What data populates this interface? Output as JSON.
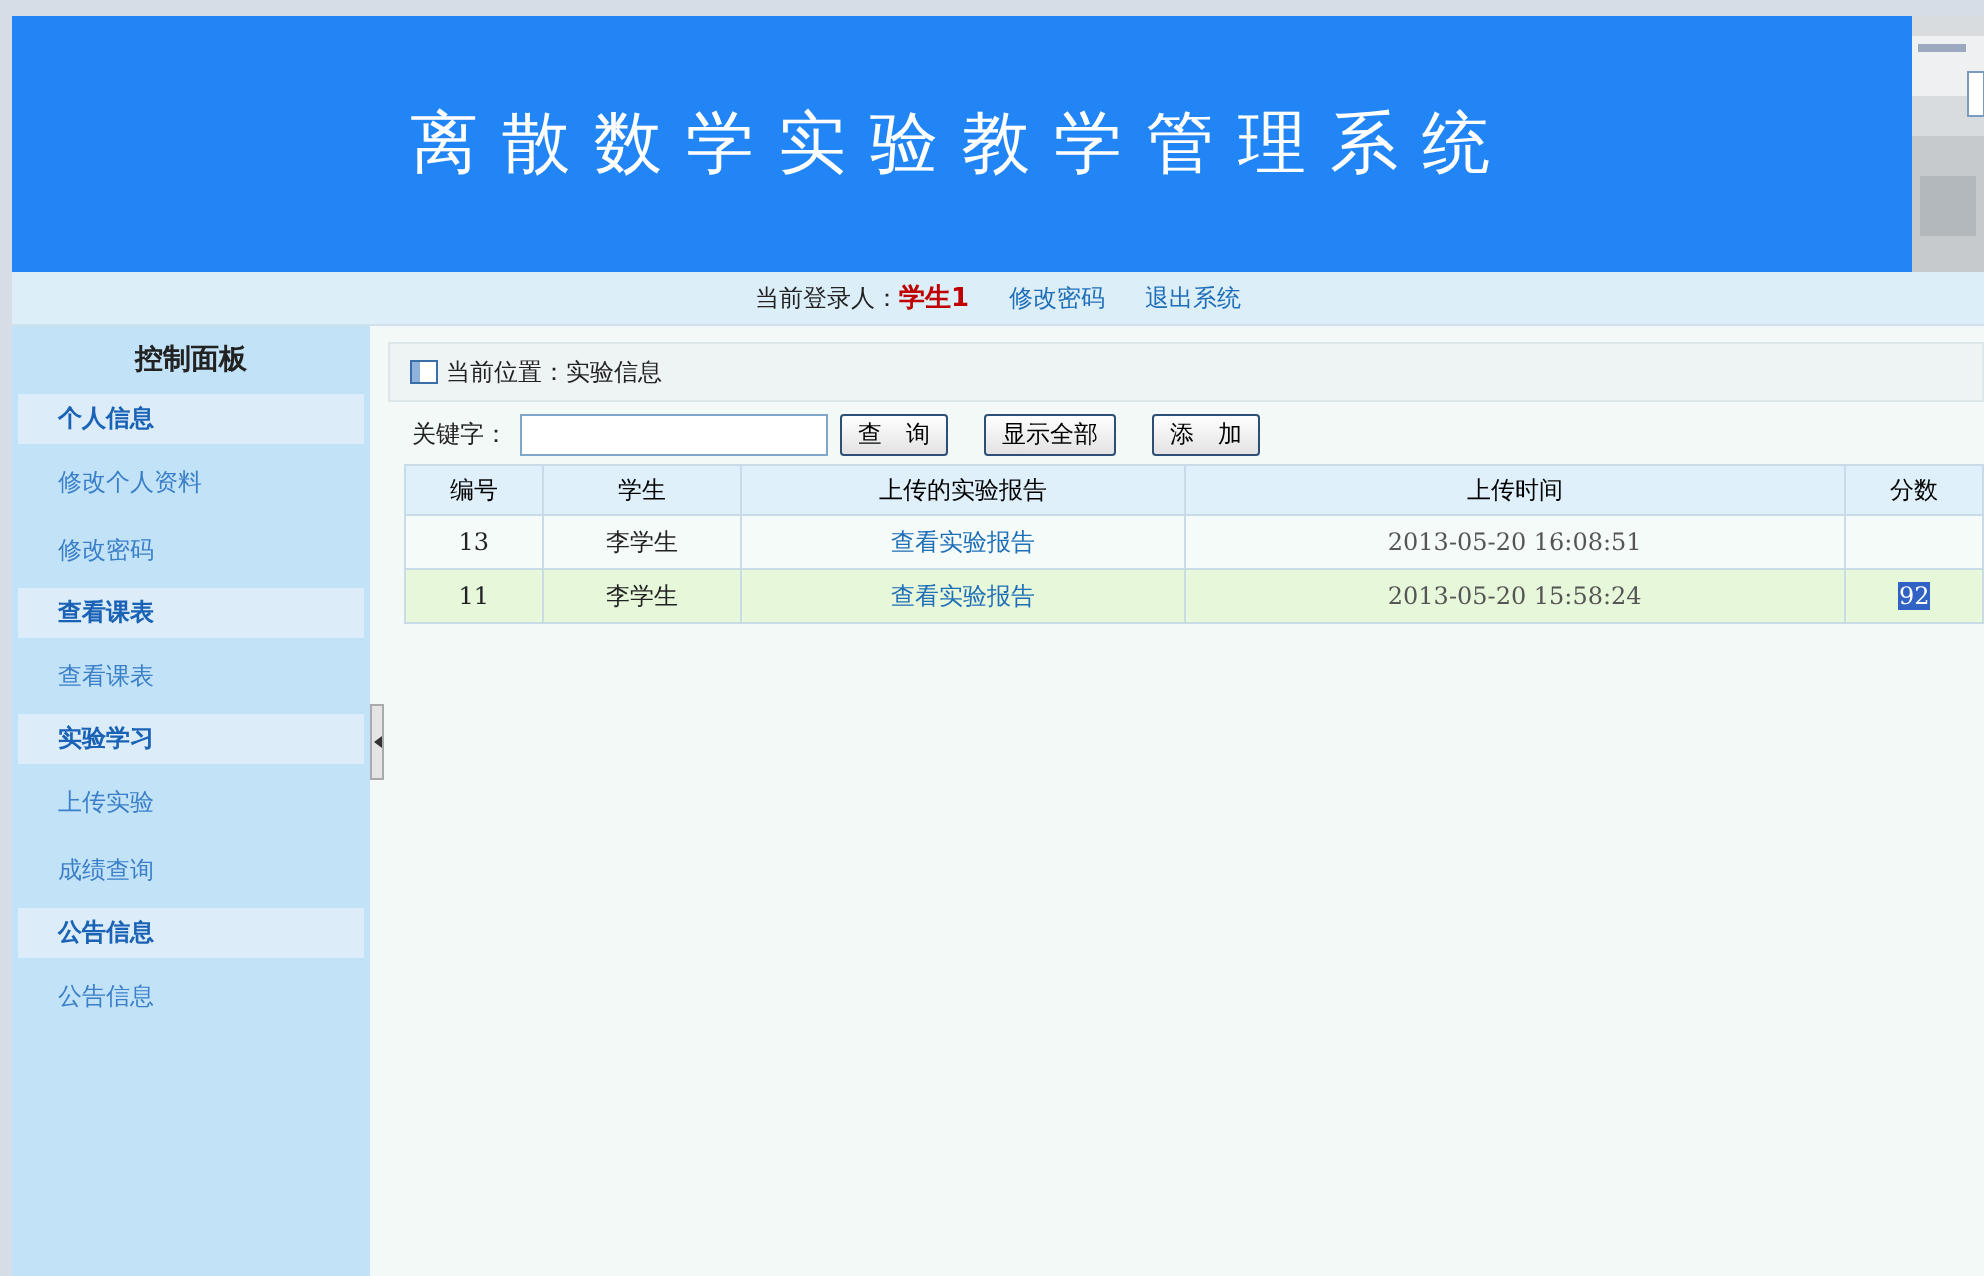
{
  "banner": {
    "title": "离散数学实验教学管理系统"
  },
  "user_bar": {
    "label": "当前登录人：",
    "user": "学生1",
    "links": [
      "修改密码",
      "退出系统"
    ]
  },
  "sidebar": {
    "title": "控制面板",
    "groups": [
      {
        "heading": "个人信息",
        "items": [
          "修改个人资料",
          "修改密码"
        ]
      },
      {
        "heading": "查看课表",
        "items": [
          "查看课表"
        ]
      },
      {
        "heading": "实验学习",
        "items": [
          "上传实验",
          "成绩查询"
        ]
      },
      {
        "heading": "公告信息",
        "items": [
          "公告信息"
        ]
      }
    ]
  },
  "breadcrumb": "当前位置：实验信息",
  "search": {
    "label": "关键字：",
    "buttons": [
      "查　询",
      "显示全部",
      "添　加"
    ]
  },
  "table": {
    "columns": [
      "编号",
      "学生",
      "上传的实验报告",
      "上传时间",
      "分数"
    ],
    "rows": [
      {
        "id": "13",
        "student": "李学生",
        "report": "查看实验报告",
        "time": "2013-05-20 16:08:51",
        "score": "",
        "selected": false
      },
      {
        "id": "11",
        "student": "李学生",
        "report": "查看实验报告",
        "time": "2013-05-20 15:58:24",
        "score": "92",
        "selected": true
      }
    ]
  }
}
